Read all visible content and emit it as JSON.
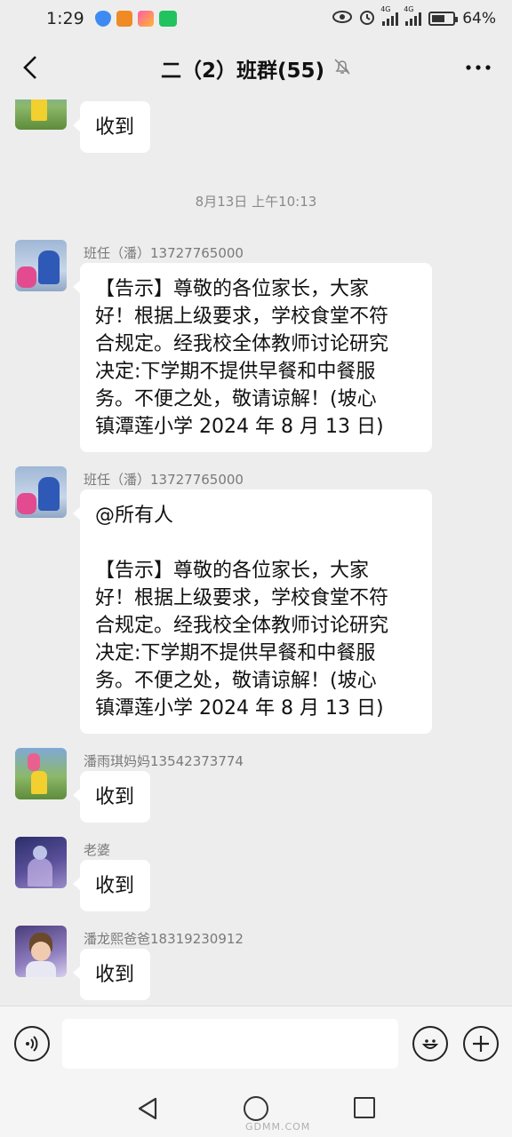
{
  "status_bar": {
    "time": "1:29",
    "battery": "64%",
    "battery_level": 0.64,
    "network_1": "4G",
    "network_2": "4G"
  },
  "header": {
    "title": "二（2）班群(55)",
    "icons": {
      "back": "back-arrow-icon",
      "mute": "bell-muted-icon",
      "more": "more-dots-icon"
    }
  },
  "chat": {
    "timestamp": "8月13日 上午10:13",
    "messages": [
      {
        "sender": "",
        "lines": [
          "收到"
        ]
      },
      {
        "sender": "班任（潘）13727765000",
        "lines": [
          "【告示】尊敬的各位家长，大家",
          "好！根据上级要求，学校食堂不符",
          "合规定。经我校全体教师讨论研究",
          "决定:下学期不提供早餐和中餐服",
          "务。不便之处，敬请谅解！(坡心",
          "镇潭莲小学 2024 年 8 月 13 日)"
        ]
      },
      {
        "sender": "班任（潘）13727765000",
        "mention": "@所有人",
        "lines": [
          "【告示】尊敬的各位家长，大家",
          "好！根据上级要求，学校食堂不符",
          "合规定。经我校全体教师讨论研究",
          "决定:下学期不提供早餐和中餐服",
          "务。不便之处，敬请谅解！(坡心",
          "镇潭莲小学 2024 年 8 月 13 日)"
        ]
      },
      {
        "sender": "潘雨琪妈妈13542373774",
        "lines": [
          "收到"
        ]
      },
      {
        "sender": "老婆",
        "lines": [
          "收到"
        ]
      },
      {
        "sender": "潘龙熙爸爸18319230912",
        "lines": [
          "收到"
        ]
      }
    ]
  },
  "input_bar": {
    "value": "",
    "icons": {
      "voice": "voice-icon",
      "emoji": "emoji-icon",
      "plus": "plus-icon"
    }
  },
  "nav_bar": {
    "icons": {
      "back": "nav-back-icon",
      "home": "nav-home-icon",
      "recent": "nav-recent-icon"
    }
  },
  "watermark": "GDMM.COM"
}
